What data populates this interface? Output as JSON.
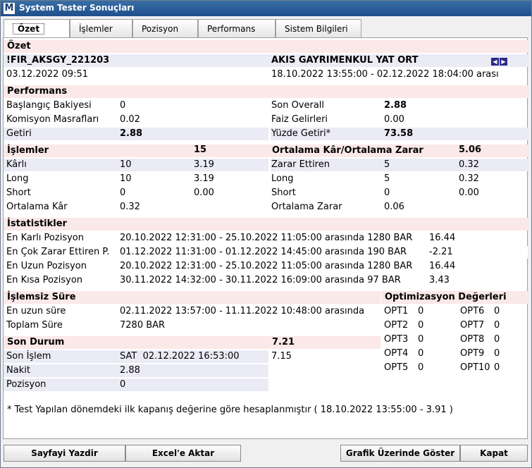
{
  "window": {
    "title": "System Tester Sonuçları",
    "logo": "M"
  },
  "tabs": [
    "Özet",
    "İşlemler",
    "Pozisyon",
    "Performans",
    "Sistem Bilgileri"
  ],
  "ozet": {
    "header": "Özet",
    "symbol": "!FIR_AKSGY_221203",
    "name": "AKIS GAYRIMENKUL YAT ORT",
    "date": "03.12.2022 09:51",
    "range": "18.10.2022 13:55:00 - 02.12.2022 18:04:00",
    "range_suffix": "arası"
  },
  "performans": {
    "header": "Performans",
    "rows": [
      {
        "l1": "Başlangıç Bakiyesi",
        "v1": "0",
        "l2": "Son Overall",
        "v2": "2.88"
      },
      {
        "l1": "Komisyon Masrafları",
        "v1": "0.02",
        "l2": "Faiz Gelirleri",
        "v2": "0.00"
      },
      {
        "l1": "Getiri",
        "v1": "2.88",
        "l2": "Yüzde Getiri*",
        "v2": "73.58"
      }
    ]
  },
  "islemler": {
    "header": "İşlemler",
    "header_value": "15",
    "header2": "Ortalama Kâr/Ortalama Zarar",
    "header2_value": "5.06",
    "rows": [
      {
        "l1": "Kârlı",
        "a1": "10",
        "b1": "3.19",
        "l2": "Zarar Ettiren",
        "a2": "5",
        "b2": "0.32"
      },
      {
        "l1": "Long",
        "a1": "10",
        "b1": "3.19",
        "l2": "Long",
        "a2": "5",
        "b2": "0.32"
      },
      {
        "l1": "Short",
        "a1": "0",
        "b1": "0.00",
        "l2": "Short",
        "a2": "0",
        "b2": "0.00"
      },
      {
        "l1": "Ortalama Kâr",
        "a1": "0.32",
        "b1": "",
        "l2": "Ortalama Zarar",
        "a2": "0.06",
        "b2": ""
      }
    ]
  },
  "istatistikler": {
    "header": "İstatistikler",
    "rows": [
      {
        "label": "En Karlı Pozisyon",
        "detail": "20.10.2022 12:31:00 - 25.10.2022 11:05:00 arasında 1280 BAR",
        "value": "16.44"
      },
      {
        "label": "En Çok Zarar Ettiren P.",
        "detail": "01.12.2022 11:31:00 - 01.12.2022 14:45:00 arasında 190 BAR",
        "value": "-2.21"
      },
      {
        "label": "En Uzun Pozisyon",
        "detail": "20.10.2022 12:31:00 - 25.10.2022 11:05:00 arasında 1280 BAR",
        "value": "16.44"
      },
      {
        "label": "En Kısa Pozisyon",
        "detail": "30.11.2022 14:32:00 - 30.11.2022 16:09:00 arasında 97 BAR",
        "value": "3.43"
      }
    ]
  },
  "islemsiz": {
    "header": "İşlemsiz Süre",
    "rows": [
      {
        "label": "En uzun süre",
        "value": "02.11.2022 13:57:00 - 11.11.2022 10:48:00 arasında"
      },
      {
        "label": "Toplam Süre",
        "value": "7280 BAR"
      }
    ]
  },
  "son_durum": {
    "header": "Son Durum",
    "header_value": "7.21",
    "rows": [
      {
        "label": "Son İşlem",
        "value": "SAT  02.12.2022 16:53:00",
        "extra": "7.15"
      },
      {
        "label": "Nakit",
        "value": "2.88",
        "extra": ""
      },
      {
        "label": "Pozisyon",
        "value": "0",
        "extra": ""
      }
    ]
  },
  "optimizasyon": {
    "header": "Optimizasyon Değerleri",
    "left": [
      {
        "name": "OPT1",
        "value": "0"
      },
      {
        "name": "OPT2",
        "value": "0"
      },
      {
        "name": "OPT3",
        "value": "0"
      },
      {
        "name": "OPT4",
        "value": "0"
      },
      {
        "name": "OPT5",
        "value": "0"
      }
    ],
    "right": [
      {
        "name": "OPT6",
        "value": "0"
      },
      {
        "name": "OPT7",
        "value": "0"
      },
      {
        "name": "OPT8",
        "value": "0"
      },
      {
        "name": "OPT9",
        "value": "0"
      },
      {
        "name": "OPT10",
        "value": "0"
      }
    ]
  },
  "note": "* Test Yapılan dönemdeki ilk kapanış değerine göre hesaplanmıştır ( 18.10.2022 13:55:00 - 3.91 )",
  "buttons": {
    "print": "Sayfayi Yazdir",
    "excel": "Excel'e Aktar",
    "chart": "Grafik Üzerinde Göster",
    "close": "Kapat"
  }
}
